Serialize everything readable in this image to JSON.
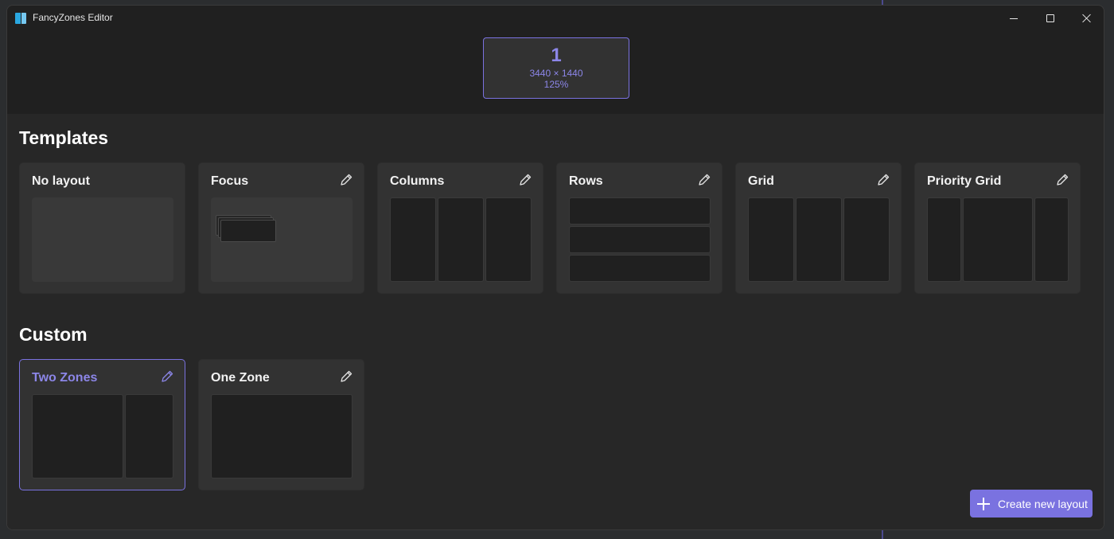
{
  "window": {
    "title": "FancyZones Editor",
    "controls": {
      "minimize": "minimize-icon",
      "maximize": "maximize-icon",
      "close": "close-icon"
    }
  },
  "monitor": {
    "number": "1",
    "resolution": "3440 × 1440",
    "scale": "125%",
    "accent_color": "#7a72e0"
  },
  "templates": {
    "title": "Templates",
    "cards": [
      {
        "name": "No layout",
        "editable": false,
        "kind": "empty"
      },
      {
        "name": "Focus",
        "editable": true,
        "kind": "focus"
      },
      {
        "name": "Columns",
        "editable": true,
        "kind": "columns"
      },
      {
        "name": "Rows",
        "editable": true,
        "kind": "rows"
      },
      {
        "name": "Grid",
        "editable": true,
        "kind": "grid"
      },
      {
        "name": "Priority Grid",
        "editable": true,
        "kind": "priority-grid"
      }
    ]
  },
  "custom": {
    "title": "Custom",
    "cards": [
      {
        "name": "Two Zones",
        "editable": true,
        "selected": true
      },
      {
        "name": "One Zone",
        "editable": true,
        "selected": false
      }
    ]
  },
  "actions": {
    "create_label": "Create new layout",
    "create_icon": "plus-icon"
  }
}
